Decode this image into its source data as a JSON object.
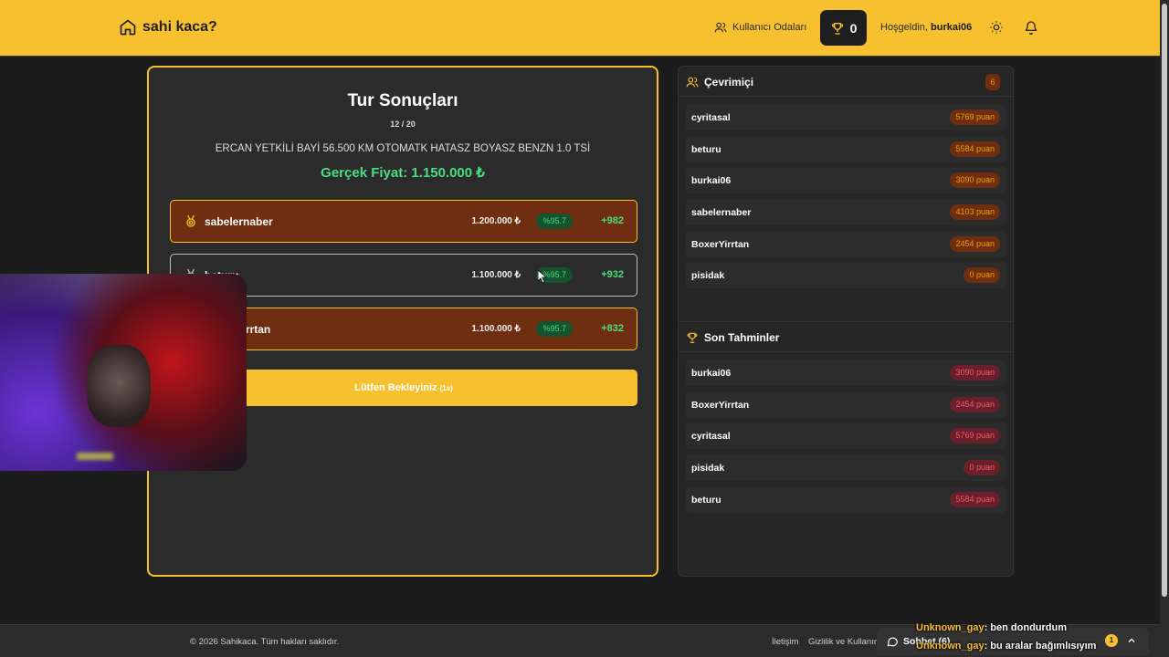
{
  "header": {
    "logo_text": "sahi kaca?",
    "rooms_label": "Kullanıcı Odaları",
    "trophy_count": "0",
    "greeting_prefix": "Hoşgeldin,",
    "username": "burkai06"
  },
  "results": {
    "title": "Tur Sonuçları",
    "round": "12 / 20",
    "car": "ERCAN YETKİLİ BAYİ 56.500 KM OTOMATK HATASZ BOYASZ BENZN 1.0 TSİ",
    "actual_price": "Gerçek Fiyat: 1.150.000 ₺",
    "rows": [
      {
        "name": "sabelernaber",
        "price": "1.200.000 ₺",
        "pct": "%95.7",
        "gain": "+982"
      },
      {
        "name": "beturu",
        "price": "1.100.000 ₺",
        "pct": "%95.7",
        "gain": "+932"
      },
      {
        "name": "BoxerYirrtan",
        "price": "1.100.000 ₺",
        "pct": "%95.7",
        "gain": "+832"
      }
    ],
    "wait_label": "Lütfen Bekleyiniz",
    "wait_timer": "(1s)"
  },
  "online": {
    "title": "Çevrimiçi",
    "count": "6",
    "users": [
      {
        "name": "cyritasal",
        "points": "5769 puan"
      },
      {
        "name": "beturu",
        "points": "5584 puan"
      },
      {
        "name": "burkai06",
        "points": "3090 puan"
      },
      {
        "name": "sabelernaber",
        "points": "4103 puan"
      },
      {
        "name": "BoxerYirrtan",
        "points": "2454 puan"
      },
      {
        "name": "pisidak",
        "points": "0 puan"
      }
    ]
  },
  "recent": {
    "title": "Son Tahminler",
    "users": [
      {
        "name": "burkai06",
        "points": "3090 puan"
      },
      {
        "name": "BoxerYirrtan",
        "points": "2454 puan"
      },
      {
        "name": "cyritasal",
        "points": "5769 puan"
      },
      {
        "name": "pisidak",
        "points": "0 puan"
      },
      {
        "name": "beturu",
        "points": "5584 puan"
      }
    ]
  },
  "footer": {
    "copyright": "© 2026 Sahikaca. Tüm hakları saklıdır.",
    "contact": "İletişim",
    "privacy": "Gizlilik ve Kullanım"
  },
  "chat": {
    "label": "Sohbet (6)",
    "unread": "1",
    "messages": [
      {
        "user": "Unknown_gay",
        "text": ": ben dondurdum"
      },
      {
        "user": "Unknown_gay",
        "text": ": bu aralar bağımlısıyım"
      }
    ]
  },
  "colors": {
    "brand": "#f7c02f",
    "success": "#4ade80",
    "background": "#1c1c1c"
  }
}
